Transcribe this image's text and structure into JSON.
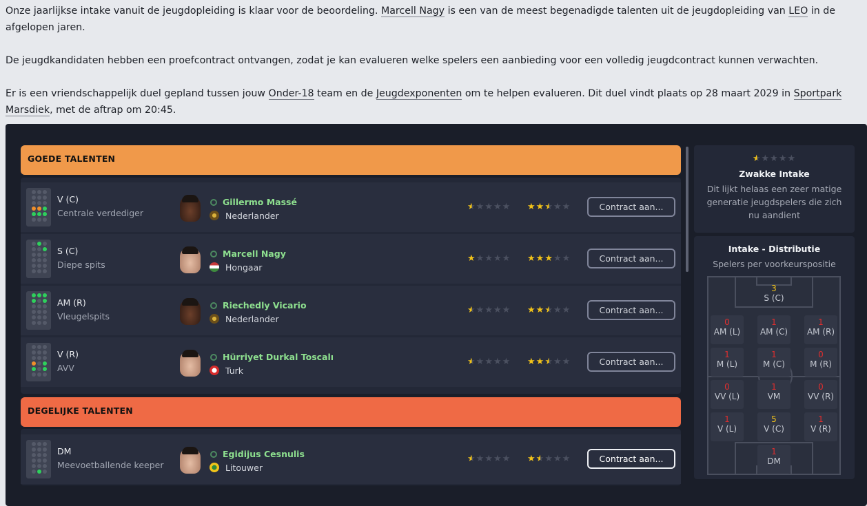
{
  "intro": {
    "p1_a": "Onze jaarlijkse intake vanuit de jeugdopleiding is klaar voor de beoordeling. ",
    "p1_link1": "Marcell Nagy",
    "p1_b": " is een van de meest begenadigde talenten uit de jeugdopleiding van ",
    "p1_link2": "LEO",
    "p1_c": " in de afgelopen jaren.",
    "p2": "De jeugdkandidaten hebben een proefcontract ontvangen, zodat je kan evalueren welke spelers een aanbieding voor een volledig jeugdcontract kunnen verwachten.",
    "p3_a": "Er is een vriendschappelijk duel gepland tussen jouw ",
    "p3_link1": "Onder-18",
    "p3_b": " team en de ",
    "p3_link2": "Jeugdexponenten",
    "p3_c": " om te helpen evalueren. Dit duel vindt plaats op 28 maart 2029 in ",
    "p3_link3": "Sportpark Marsdiek",
    "p3_d": ", met de aftrap om 20:45."
  },
  "sections": {
    "good_title": "GOEDE TALENTEN",
    "ok_title": "DEGELIJKE TALENTEN"
  },
  "players": [
    {
      "position": "V (C)",
      "role": "Centrale verdediger",
      "name": "Gillermo Massé",
      "nationality": "Nederlander",
      "current_ability": 0.5,
      "potential_ability": 2.5,
      "button": "Contract aan..."
    },
    {
      "position": "S (C)",
      "role": "Diepe spits",
      "name": "Marcell Nagy",
      "nationality": "Hongaar",
      "current_ability": 1,
      "potential_ability": 3,
      "button": "Contract aan..."
    },
    {
      "position": "AM (R)",
      "role": "Vleugelspits",
      "name": "Riechedly Vicario",
      "nationality": "Nederlander",
      "current_ability": 0.5,
      "potential_ability": 2.5,
      "button": "Contract aan..."
    },
    {
      "position": "V (R)",
      "role": "AVV",
      "name": "Hürriyet Durkal Toscalı",
      "nationality": "Turk",
      "current_ability": 0.5,
      "potential_ability": 2.5,
      "button": "Contract aan..."
    },
    {
      "position": "DM",
      "role": "Meevoetballende keeper",
      "name": "Egidijus Cesnulis",
      "nationality": "Litouwer",
      "current_ability": 0.5,
      "potential_ability": 1.5,
      "button": "Contract aan..."
    }
  ],
  "intake": {
    "rating": 0.5,
    "title": "Zwakke Intake",
    "description": "Dit lijkt helaas een zeer matige generatie jeugdspelers die zich nu aandient"
  },
  "distribution": {
    "title": "Intake - Distributie",
    "subtitle": "Spelers per voorkeurspositie",
    "positions": {
      "st": {
        "count": "3",
        "label": "S (C)"
      },
      "aml": {
        "count": "0",
        "label": "AM (L)"
      },
      "amc": {
        "count": "1",
        "label": "AM (C)"
      },
      "amr": {
        "count": "1",
        "label": "AM (R)"
      },
      "ml": {
        "count": "1",
        "label": "M (L)"
      },
      "mc": {
        "count": "1",
        "label": "M (C)"
      },
      "mr": {
        "count": "0",
        "label": "M (R)"
      },
      "wbl": {
        "count": "0",
        "label": "VV (L)"
      },
      "dm": {
        "count": "1",
        "label": "VM"
      },
      "wbr": {
        "count": "0",
        "label": "VV (R)"
      },
      "dl": {
        "count": "1",
        "label": "V (L)"
      },
      "dc": {
        "count": "5",
        "label": "V (C)"
      },
      "dr": {
        "count": "1",
        "label": "V (R)"
      },
      "gk": {
        "count": "1",
        "label": "DM"
      }
    }
  },
  "colors": {
    "good_header": "#f0994a",
    "ok_header": "#ef6a45",
    "player_name": "#8ee08f",
    "star": "#f2c319"
  }
}
